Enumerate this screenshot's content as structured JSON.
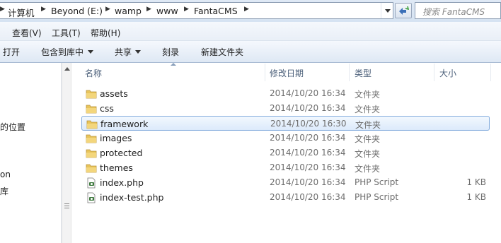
{
  "address_bar": {
    "crumbs": [
      "计算机",
      "Beyond (E:)",
      "wamp",
      "www",
      "FantaCMS"
    ],
    "search_placeholder": "搜索 FantaCMS"
  },
  "menu": [
    "查看(V)",
    "工具(T)",
    "帮助(H)"
  ],
  "toolbar": {
    "open": "打开",
    "include_library": "包含到库中",
    "share": "共享",
    "burn": "刻录",
    "new_folder": "新建文件夹"
  },
  "nav_pane": {
    "items": [
      "的位置",
      "on",
      "库"
    ]
  },
  "columns": {
    "name": "名称",
    "date": "修改日期",
    "type": "类型",
    "size": "大小"
  },
  "files": [
    {
      "name": "assets",
      "date": "2014/10/20 16:34",
      "type": "文件夹",
      "size": "",
      "kind": "folder",
      "selected": false
    },
    {
      "name": "css",
      "date": "2014/10/20 16:34",
      "type": "文件夹",
      "size": "",
      "kind": "folder",
      "selected": false
    },
    {
      "name": "framework",
      "date": "2014/10/20 16:30",
      "type": "文件夹",
      "size": "",
      "kind": "folder",
      "selected": true
    },
    {
      "name": "images",
      "date": "2014/10/20 16:34",
      "type": "文件夹",
      "size": "",
      "kind": "folder",
      "selected": false
    },
    {
      "name": "protected",
      "date": "2014/10/20 16:34",
      "type": "文件夹",
      "size": "",
      "kind": "folder",
      "selected": false
    },
    {
      "name": "themes",
      "date": "2014/10/20 16:34",
      "type": "文件夹",
      "size": "",
      "kind": "folder",
      "selected": false
    },
    {
      "name": "index.php",
      "date": "2014/10/20 16:34",
      "type": "PHP Script",
      "size": "1 KB",
      "kind": "php",
      "selected": false
    },
    {
      "name": "index-test.php",
      "date": "2014/10/20 16:34",
      "type": "PHP Script",
      "size": "1 KB",
      "kind": "php",
      "selected": false
    }
  ],
  "colors": {
    "folder": "#e8c45a",
    "selection_border": "#84acdd",
    "header_text": "#4c607a"
  }
}
